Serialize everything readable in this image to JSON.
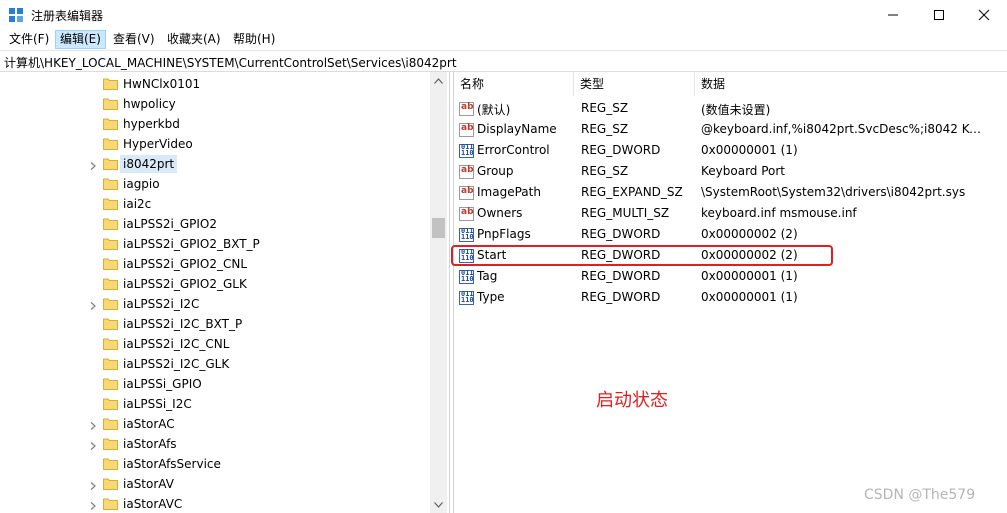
{
  "window": {
    "title": "注册表编辑器",
    "controls": [
      "minimize",
      "maximize",
      "close"
    ]
  },
  "menu": {
    "items": [
      "文件(F)",
      "编辑(E)",
      "查看(V)",
      "收藏夹(A)",
      "帮助(H)"
    ],
    "selected_index": 1
  },
  "address": {
    "path": "计算机\\HKEY_LOCAL_MACHINE\\SYSTEM\\CurrentControlSet\\Services\\i8042prt"
  },
  "tree": {
    "items": [
      {
        "label": "HwNClx0101",
        "expandable": false,
        "selected": false
      },
      {
        "label": "hwpolicy",
        "expandable": false,
        "selected": false
      },
      {
        "label": "hyperkbd",
        "expandable": false,
        "selected": false
      },
      {
        "label": "HyperVideo",
        "expandable": false,
        "selected": false
      },
      {
        "label": "i8042prt",
        "expandable": true,
        "selected": true
      },
      {
        "label": "iagpio",
        "expandable": false,
        "selected": false
      },
      {
        "label": "iai2c",
        "expandable": false,
        "selected": false
      },
      {
        "label": "iaLPSS2i_GPIO2",
        "expandable": false,
        "selected": false
      },
      {
        "label": "iaLPSS2i_GPIO2_BXT_P",
        "expandable": false,
        "selected": false
      },
      {
        "label": "iaLPSS2i_GPIO2_CNL",
        "expandable": false,
        "selected": false
      },
      {
        "label": "iaLPSS2i_GPIO2_GLK",
        "expandable": false,
        "selected": false
      },
      {
        "label": "iaLPSS2i_I2C",
        "expandable": true,
        "selected": false
      },
      {
        "label": "iaLPSS2i_I2C_BXT_P",
        "expandable": false,
        "selected": false
      },
      {
        "label": "iaLPSS2i_I2C_CNL",
        "expandable": false,
        "selected": false
      },
      {
        "label": "iaLPSS2i_I2C_GLK",
        "expandable": false,
        "selected": false
      },
      {
        "label": "iaLPSSi_GPIO",
        "expandable": false,
        "selected": false
      },
      {
        "label": "iaLPSSi_I2C",
        "expandable": false,
        "selected": false
      },
      {
        "label": "iaStorAC",
        "expandable": true,
        "selected": false
      },
      {
        "label": "iaStorAfs",
        "expandable": true,
        "selected": false
      },
      {
        "label": "iaStorAfsService",
        "expandable": false,
        "selected": false
      },
      {
        "label": "iaStorAV",
        "expandable": true,
        "selected": false
      },
      {
        "label": "iaStorAVC",
        "expandable": true,
        "selected": false
      }
    ]
  },
  "columns": {
    "name": "名称",
    "type": "类型",
    "data": "数据"
  },
  "values": [
    {
      "icon": "string-value-icon",
      "name": "(默认)",
      "type": "REG_SZ",
      "data": "(数值未设置)"
    },
    {
      "icon": "string-value-icon",
      "name": "DisplayName",
      "type": "REG_SZ",
      "data": "@keyboard.inf,%i8042prt.SvcDesc%;i8042 Key..."
    },
    {
      "icon": "binary-value-icon",
      "name": "ErrorControl",
      "type": "REG_DWORD",
      "data": "0x00000001 (1)"
    },
    {
      "icon": "string-value-icon",
      "name": "Group",
      "type": "REG_SZ",
      "data": "Keyboard Port"
    },
    {
      "icon": "string-value-icon",
      "name": "ImagePath",
      "type": "REG_EXPAND_SZ",
      "data": "\\SystemRoot\\System32\\drivers\\i8042prt.sys"
    },
    {
      "icon": "string-value-icon",
      "name": "Owners",
      "type": "REG_MULTI_SZ",
      "data": "keyboard.inf msmouse.inf"
    },
    {
      "icon": "binary-value-icon",
      "name": "PnpFlags",
      "type": "REG_DWORD",
      "data": "0x00000002 (2)"
    },
    {
      "icon": "binary-value-icon",
      "name": "Start",
      "type": "REG_DWORD",
      "data": "0x00000002 (2)"
    },
    {
      "icon": "binary-value-icon",
      "name": "Tag",
      "type": "REG_DWORD",
      "data": "0x00000001 (1)"
    },
    {
      "icon": "binary-value-icon",
      "name": "Type",
      "type": "REG_DWORD",
      "data": "0x00000001 (1)"
    }
  ],
  "annotation": {
    "text": "启动状态",
    "color": "#e02020"
  },
  "watermark": {
    "text": "CSDN @The579"
  }
}
